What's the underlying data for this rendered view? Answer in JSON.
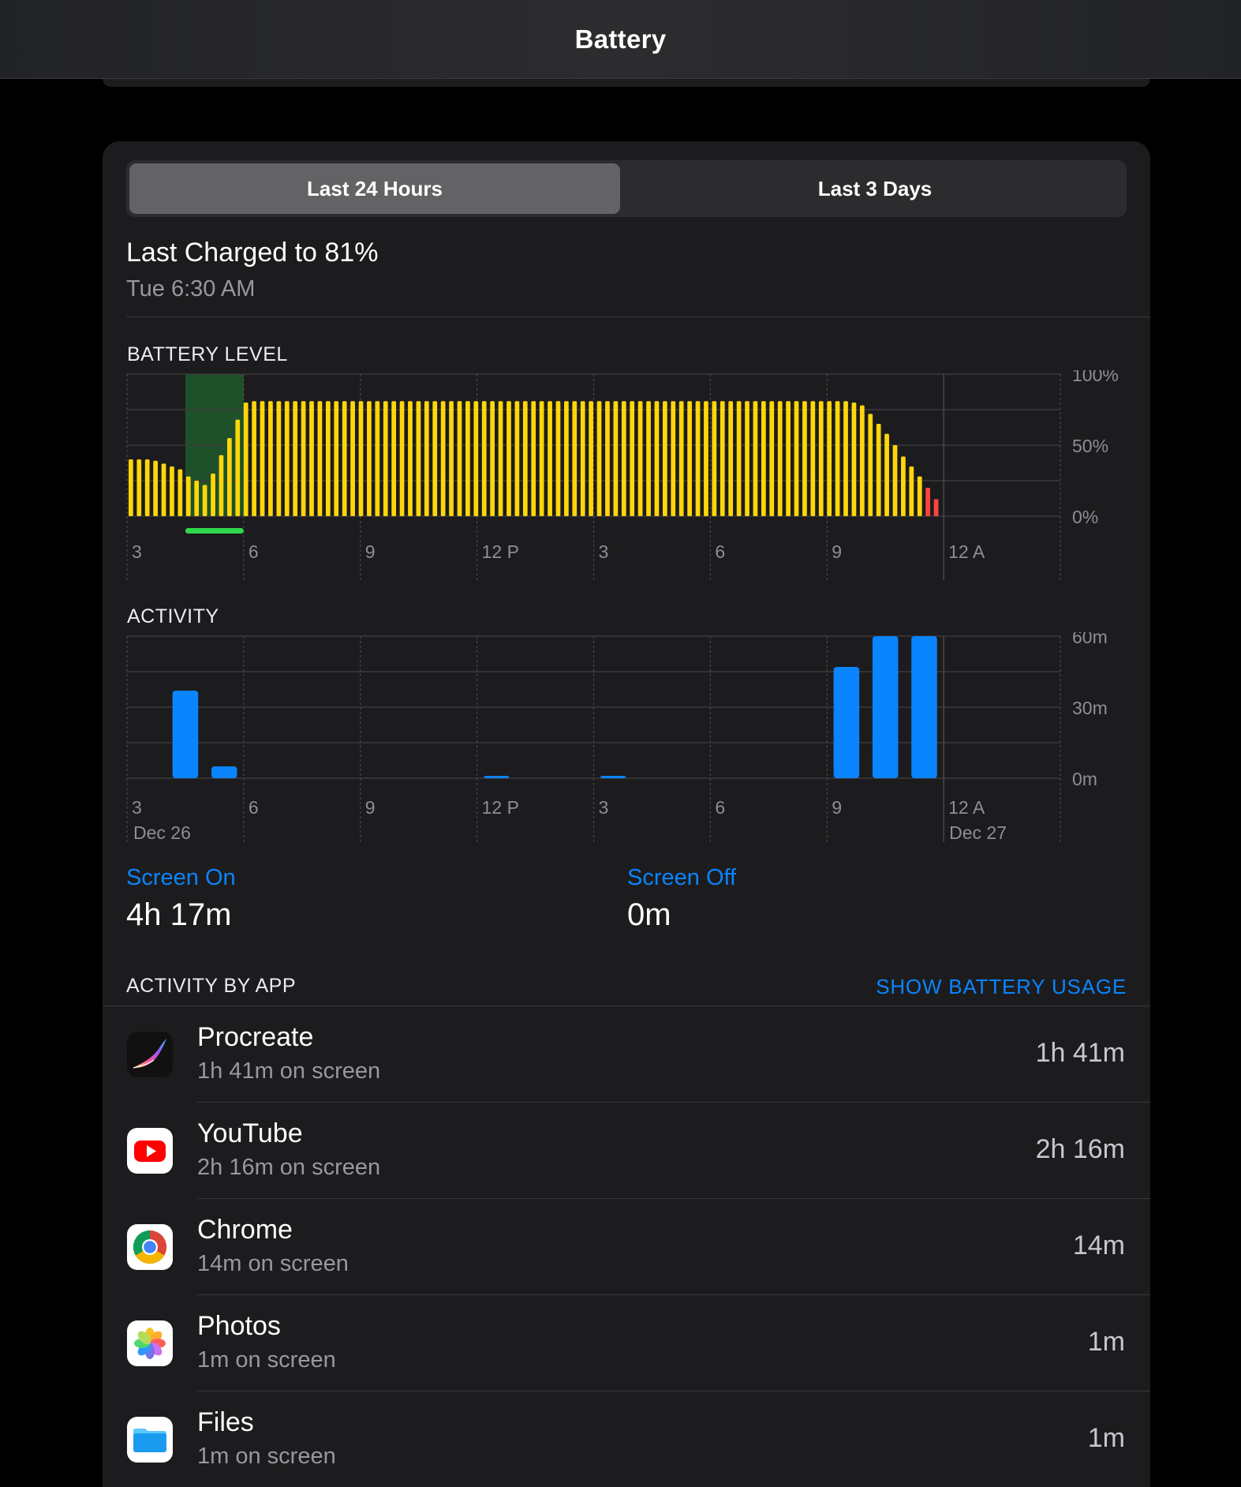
{
  "nav": {
    "title": "Battery"
  },
  "segments": {
    "active": "Last 24 Hours",
    "inactive": "Last 3 Days"
  },
  "last_charged": {
    "title": "Last Charged to 81%",
    "time": "Tue 6:30 AM"
  },
  "battery_section_label": "BATTERY LEVEL",
  "activity_section_label": "ACTIVITY",
  "chart_data": [
    {
      "type": "bar",
      "title": "BATTERY LEVEL",
      "x_ticks": [
        "3",
        "6",
        "9",
        "12 P",
        "3",
        "6",
        "9",
        "12 A"
      ],
      "y_ticks": [
        "100%",
        "50%",
        "0%"
      ],
      "ylim": [
        0,
        100
      ],
      "grid": true,
      "colors": {
        "normal": "#ffd60a",
        "low": "#ff453a",
        "charging_band": "#1e5a2c",
        "charging_marker": "#32d74b"
      },
      "charging_period": [
        "4:30 AM",
        "6:00 AM"
      ],
      "values": [
        40,
        40,
        40,
        39,
        37,
        35,
        33,
        28,
        25,
        22,
        30,
        43,
        55,
        68,
        80,
        81,
        81,
        81,
        81,
        81,
        81,
        81,
        81,
        81,
        81,
        81,
        81,
        81,
        81,
        81,
        81,
        81,
        81,
        81,
        81,
        81,
        81,
        81,
        81,
        81,
        81,
        81,
        81,
        81,
        81,
        81,
        81,
        81,
        81,
        81,
        81,
        81,
        81,
        81,
        81,
        81,
        81,
        81,
        81,
        81,
        81,
        81,
        81,
        81,
        81,
        81,
        81,
        81,
        81,
        81,
        81,
        81,
        81,
        81,
        81,
        81,
        81,
        81,
        81,
        81,
        81,
        81,
        81,
        81,
        81,
        81,
        81,
        81,
        80,
        78,
        72,
        65,
        58,
        50,
        42,
        35,
        28,
        20,
        12
      ]
    },
    {
      "type": "bar",
      "title": "ACTIVITY",
      "x_ticks": [
        "3",
        "6",
        "9",
        "12 P",
        "3",
        "6",
        "9",
        "12 A"
      ],
      "date_labels": [
        "Dec 26",
        "Dec 27"
      ],
      "y_ticks": [
        "60m",
        "30m",
        "0m"
      ],
      "ylim": [
        0,
        60
      ],
      "grid": true,
      "color": "#0a84ff",
      "categories": [
        "3-4 AM",
        "4-5 AM",
        "5-6 AM",
        "6-7 AM",
        "7-8 AM",
        "8-9 AM",
        "9-10 AM",
        "10-11 AM",
        "11 AM-12 PM",
        "12-1 PM",
        "1-2 PM",
        "2-3 PM",
        "3-4 PM",
        "4-5 PM",
        "5-6 PM",
        "6-7 PM",
        "7-8 PM",
        "8-9 PM",
        "9-10 PM",
        "10-11 PM",
        "11 PM-12 AM",
        "12-1 AM",
        "1-2 AM",
        "2-3 AM"
      ],
      "values": [
        0,
        37,
        5,
        0,
        0,
        0,
        0,
        0,
        0,
        1,
        0,
        0,
        1,
        0,
        0,
        0,
        0,
        0,
        47,
        60,
        60,
        0,
        0,
        0
      ]
    }
  ],
  "screen_on": {
    "label": "Screen On",
    "value": "4h 17m"
  },
  "screen_off": {
    "label": "Screen Off",
    "value": "0m"
  },
  "activity_by_app": {
    "label": "ACTIVITY BY APP",
    "action": "SHOW BATTERY USAGE",
    "apps": [
      {
        "name": "Procreate",
        "sub": "1h 41m on screen",
        "time": "1h 41m",
        "icon": "procreate-icon"
      },
      {
        "name": "YouTube",
        "sub": "2h 16m on screen",
        "time": "2h 16m",
        "icon": "youtube-icon"
      },
      {
        "name": "Chrome",
        "sub": "14m on screen",
        "time": "14m",
        "icon": "chrome-icon"
      },
      {
        "name": "Photos",
        "sub": "1m on screen",
        "time": "1m",
        "icon": "photos-icon"
      },
      {
        "name": "Files",
        "sub": "1m on screen",
        "time": "1m",
        "icon": "files-icon"
      }
    ]
  }
}
